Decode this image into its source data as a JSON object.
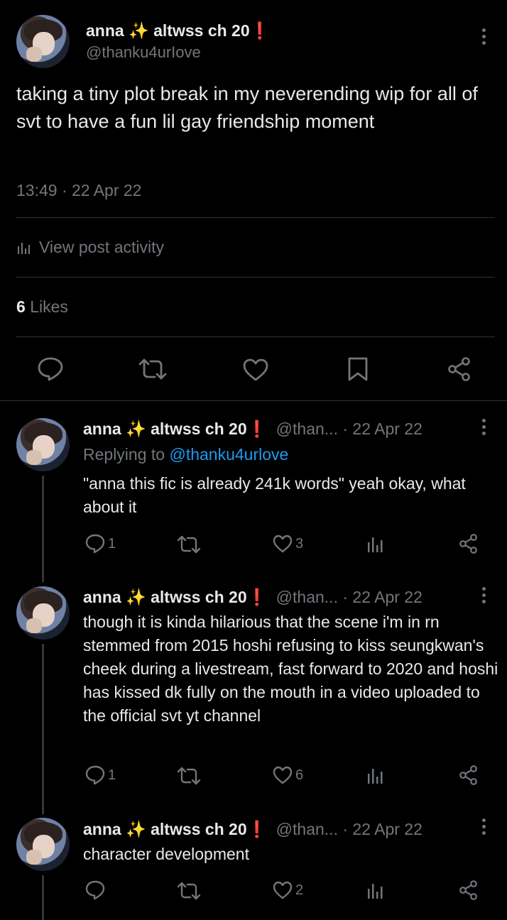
{
  "main_tweet": {
    "display_name": "anna",
    "name_suffix": "altwss ch 20",
    "handle": "@thanku4urIove",
    "text": "taking a tiny plot break in my neverending wip for all of svt to have a fun lil gay friendship moment",
    "timestamp": "13:49 · 22 Apr 22",
    "activity_label": "View post activity",
    "likes_count": "6",
    "likes_label": "Likes"
  },
  "replies": [
    {
      "display_name": "anna",
      "name_suffix": "altwss ch 20",
      "handle": "@than...",
      "date": "· 22 Apr 22",
      "replying_prefix": "Replying to",
      "replying_handle": "@thanku4urlove",
      "text": "\"anna this fic is already 241k words\" yeah okay, what about it",
      "reply_count": "1",
      "retweet_count": "",
      "like_count": "3"
    },
    {
      "display_name": "anna",
      "name_suffix": "altwss ch 20",
      "handle": "@than...",
      "date": "· 22 Apr 22",
      "text": "though it is kinda hilarious that the scene i'm in rn stemmed from 2015 hoshi refusing to kiss seungkwan's cheek during a livestream, fast forward to 2020 and hoshi has kissed dk fully on the mouth in a video uploaded to the official svt yt channel",
      "reply_count": "1",
      "retweet_count": "",
      "like_count": "6"
    },
    {
      "display_name": "anna",
      "name_suffix": "altwss ch 20",
      "handle": "@than...",
      "date": "· 22 Apr 22",
      "text": "character development",
      "reply_count": "",
      "retweet_count": "",
      "like_count": "2"
    }
  ],
  "icons": {
    "sparkle": "✨",
    "exclamation": "❗"
  },
  "colors": {
    "background": "#000000",
    "text": "#e7e9ea",
    "secondary": "#71767b",
    "link": "#1d9bf0"
  }
}
